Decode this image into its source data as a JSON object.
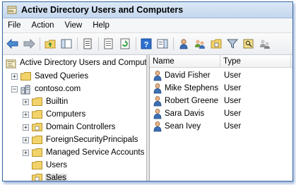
{
  "window": {
    "title": "Active Directory Users and Computers"
  },
  "menu": [
    "File",
    "Action",
    "View",
    "Help"
  ],
  "toolbar_icons": [
    "back-arrow-icon",
    "forward-arrow-icon",
    "up-folder-icon",
    "show-hide-console-tree-icon",
    "properties-icon",
    "export-list-icon",
    "refresh-icon",
    "help-icon",
    "action-pane-icon",
    "new-user-icon",
    "new-group-icon",
    "new-ou-icon",
    "filter-icon",
    "find-icon",
    "add-to-group-icon"
  ],
  "tree": {
    "root": "Active Directory Users and Comput",
    "saved_queries": "Saved Queries",
    "domain": "contoso.com",
    "items": [
      {
        "label": "Builtin",
        "expander": "+"
      },
      {
        "label": "Computers",
        "expander": "+"
      },
      {
        "label": "Domain Controllers",
        "expander": "+"
      },
      {
        "label": "ForeignSecurityPrincipals",
        "expander": "+"
      },
      {
        "label": "Managed Service Accounts",
        "expander": "+"
      },
      {
        "label": "Users",
        "expander": ""
      },
      {
        "label": "Sales",
        "expander": ""
      }
    ],
    "selected": "Sales",
    "saved_queries_expander": "+",
    "domain_expander": "−"
  },
  "list": {
    "columns": [
      "Name",
      "Type"
    ],
    "rows": [
      {
        "name": "David Fisher",
        "type": "User"
      },
      {
        "name": "Mike Stephens",
        "type": "User"
      },
      {
        "name": "Robert Greene",
        "type": "User"
      },
      {
        "name": "Sara Davis",
        "type": "User"
      },
      {
        "name": "Sean Ivey",
        "type": "User"
      }
    ]
  },
  "colors": {
    "title_bg": "#c4d7ee",
    "frame": "#3c6aa0",
    "folder": "#f2d36b",
    "selection": "#dcdcdc"
  }
}
